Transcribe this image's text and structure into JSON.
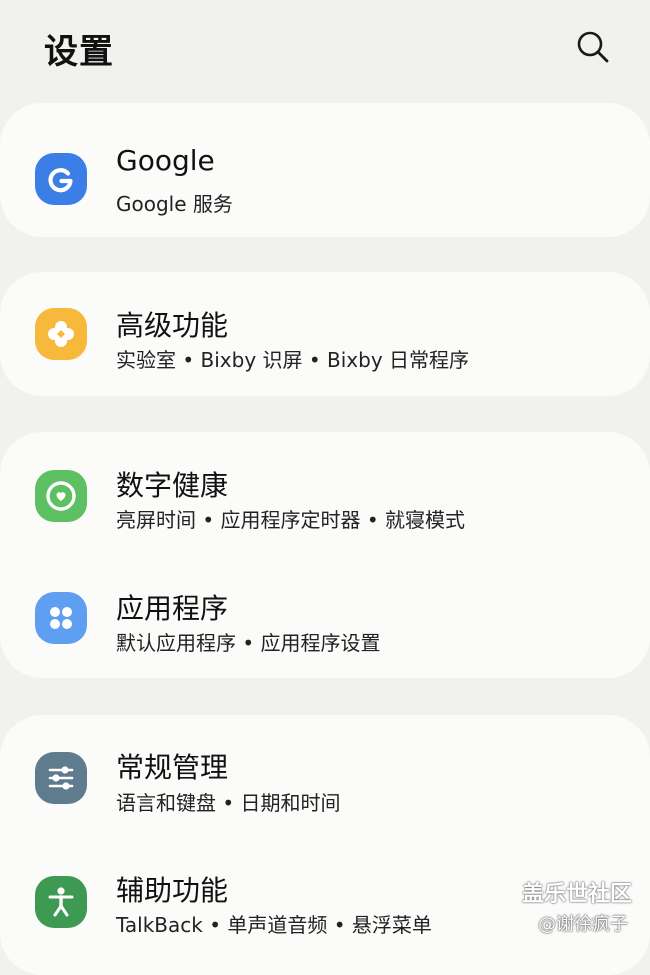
{
  "header": {
    "title": "设置",
    "search_icon": "search-icon"
  },
  "cards": [
    {
      "items": [
        {
          "icon": "google-icon",
          "icon_color": "#3b7ee6",
          "icon_glyph": "G",
          "title": "Google",
          "subtitle": "Google 服务"
        }
      ]
    },
    {
      "items": [
        {
          "icon": "advanced-features-icon",
          "icon_color": "#f6b93b",
          "title": "高级功能",
          "subtitle": "实验室 • Bixby 识屏 • Bixby 日常程序"
        }
      ]
    },
    {
      "items": [
        {
          "icon": "digital-wellbeing-icon",
          "icon_color": "#5dc062",
          "title": "数字健康",
          "subtitle": "亮屏时间 • 应用程序定时器 • 就寝模式"
        },
        {
          "icon": "apps-icon",
          "icon_color": "#5f9ff2",
          "title": "应用程序",
          "subtitle": "默认应用程序 • 应用程序设置"
        }
      ]
    },
    {
      "items": [
        {
          "icon": "general-management-icon",
          "icon_color": "#5f7c8f",
          "title": "常规管理",
          "subtitle": "语言和键盘 • 日期和时间"
        },
        {
          "icon": "accessibility-icon",
          "icon_color": "#3e9a52",
          "title": "辅助功能",
          "subtitle": "TalkBack • 单声道音频 • 悬浮菜单"
        }
      ]
    }
  ],
  "watermark": {
    "line1": "盖乐世社区",
    "line2": "@谢徐疯子"
  }
}
